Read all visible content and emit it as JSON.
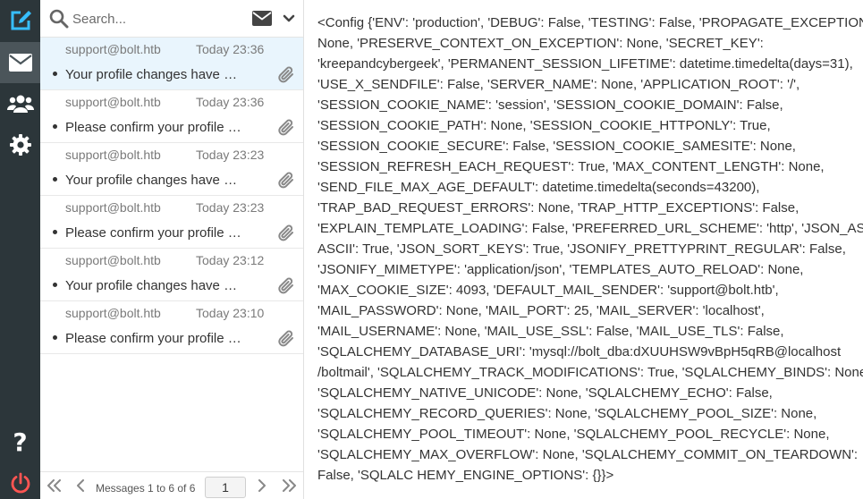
{
  "rail": {
    "items": [
      {
        "name": "compose",
        "icon": "compose-icon"
      },
      {
        "name": "mail",
        "icon": "envelope-icon"
      },
      {
        "name": "contacts",
        "icon": "contacts-icon"
      },
      {
        "name": "settings",
        "icon": "gear-icon"
      },
      {
        "name": "help",
        "icon": "help-icon"
      },
      {
        "name": "logout",
        "icon": "power-icon"
      }
    ],
    "colors": {
      "accent": "#37beff",
      "background": "#2c363a",
      "active": "#4b555a",
      "logout": "#ff5552"
    }
  },
  "search": {
    "placeholder": "Search..."
  },
  "messages": [
    {
      "from": "support@bolt.htb",
      "date": "Today 23:36",
      "subject": "Your profile changes have been submitted",
      "selected": true
    },
    {
      "from": "support@bolt.htb",
      "date": "Today 23:36",
      "subject": "Please confirm your profile changes",
      "selected": false
    },
    {
      "from": "support@bolt.htb",
      "date": "Today 23:23",
      "subject": "Your profile changes have been submitted",
      "selected": false
    },
    {
      "from": "support@bolt.htb",
      "date": "Today 23:23",
      "subject": "Please confirm your profile changes",
      "selected": false
    },
    {
      "from": "support@bolt.htb",
      "date": "Today 23:12",
      "subject": "Your profile changes have been submitted",
      "selected": false
    },
    {
      "from": "support@bolt.htb",
      "date": "Today 23:10",
      "subject": "Please confirm your profile changes",
      "selected": false
    }
  ],
  "pagination": {
    "count_text": "Messages 1 to 6 of 6",
    "page": "1"
  },
  "body": {
    "lines": [
      "<Config {'ENV': 'production', 'DEBUG': False, 'TESTING': False, 'PROPAGATE_EXCEPTIONS':",
      "None, 'PRESERVE_CONTEXT_ON_EXCEPTION': None, 'SECRET_KEY':",
      "'kreepandcybergeek', 'PERMANENT_SESSION_LIFETIME': datetime.timedelta(days=31),",
      "'USE_X_SENDFILE': False, 'SERVER_NAME': None, 'APPLICATION_ROOT': '/',",
      "'SESSION_COOKIE_NAME': 'session', 'SESSION_COOKIE_DOMAIN': False,",
      "'SESSION_COOKIE_PATH': None, 'SESSION_COOKIE_HTTPONLY': True,",
      "'SESSION_COOKIE_SECURE': False, 'SESSION_COOKIE_SAMESITE': None,",
      "'SESSION_REFRESH_EACH_REQUEST': True, 'MAX_CONTENT_LENGTH': None,",
      "'SEND_FILE_MAX_AGE_DEFAULT': datetime.timedelta(seconds=43200),",
      "'TRAP_BAD_REQUEST_ERRORS': None, 'TRAP_HTTP_EXCEPTIONS': False,",
      "'EXPLAIN_TEMPLATE_LOADING': False, 'PREFERRED_URL_SCHEME': 'http', 'JSON_AS_",
      "ASCII': True, 'JSON_SORT_KEYS': True, 'JSONIFY_PRETTYPRINT_REGULAR': False,",
      "'JSONIFY_MIMETYPE': 'application/json', 'TEMPLATES_AUTO_RELOAD': None,",
      "'MAX_COOKIE_SIZE': 4093, 'DEFAULT_MAIL_SENDER': 'support@bolt.htb',",
      "'MAIL_PASSWORD': None, 'MAIL_PORT': 25, 'MAIL_SERVER': 'localhost',",
      "'MAIL_USERNAME': None, 'MAIL_USE_SSL': False, 'MAIL_USE_TLS': False,",
      "'SQLALCHEMY_DATABASE_URI': 'mysql://bolt_dba:dXUUHSW9vBpH5qRB@localhost",
      "/boltmail', 'SQLALCHEMY_TRACK_MODIFICATIONS': True, 'SQLALCHEMY_BINDS': None,",
      "'SQLALCHEMY_NATIVE_UNICODE': None, 'SQLALCHEMY_ECHO': False,",
      "'SQLALCHEMY_RECORD_QUERIES': None, 'SQLALCHEMY_POOL_SIZE': None,",
      "'SQLALCHEMY_POOL_TIMEOUT': None, 'SQLALCHEMY_POOL_RECYCLE': None,",
      "'SQLALCHEMY_MAX_OVERFLOW': None, 'SQLALCHEMY_COMMIT_ON_TEARDOWN':",
      "False, 'SQLALC HEMY_ENGINE_OPTIONS': {}}>"
    ]
  }
}
